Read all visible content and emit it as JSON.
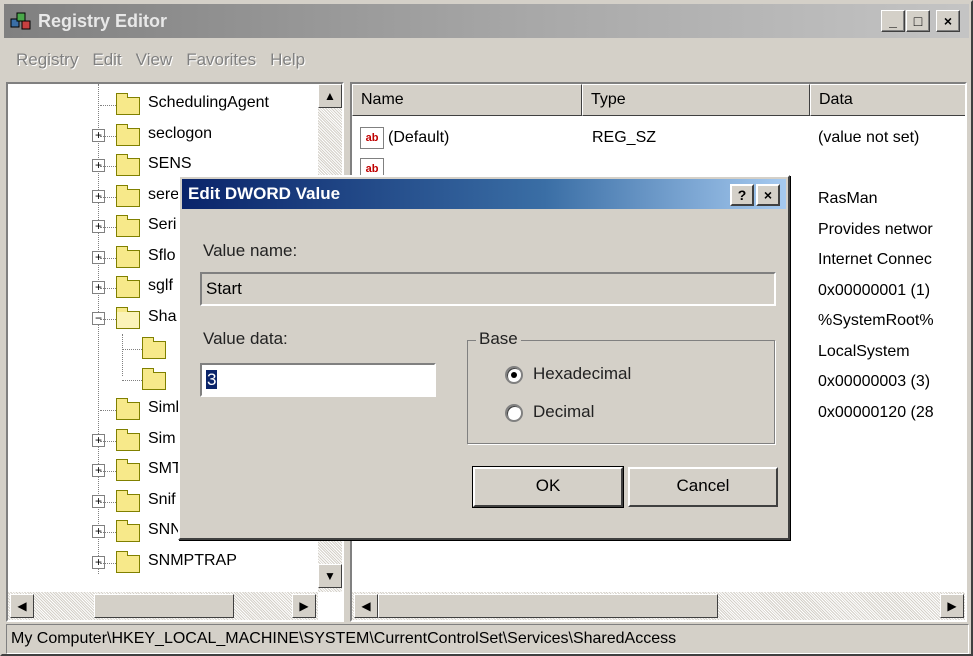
{
  "window": {
    "title": "Registry Editor",
    "minimize": "_",
    "maximize": "□",
    "close": "×"
  },
  "menu": [
    "Registry",
    "Edit",
    "View",
    "Favorites",
    "Help"
  ],
  "tree": [
    {
      "label": "SchedulingAgent",
      "expander": ""
    },
    {
      "label": "seclogon",
      "expander": "+"
    },
    {
      "label": "SENS",
      "expander": "+"
    },
    {
      "label": "sere",
      "expander": "+"
    },
    {
      "label": "Seri",
      "expander": "+"
    },
    {
      "label": "Sflo",
      "expander": "+"
    },
    {
      "label": "sglf",
      "expander": "+"
    },
    {
      "label": "Sha",
      "expander": "−"
    },
    {
      "label": "",
      "expander": ""
    },
    {
      "label": "",
      "expander": ""
    },
    {
      "label": "Siml",
      "expander": ""
    },
    {
      "label": "Sim",
      "expander": "+"
    },
    {
      "label": "SMT",
      "expander": "+"
    },
    {
      "label": "Snif",
      "expander": "+"
    },
    {
      "label": "SNN",
      "expander": "+"
    },
    {
      "label": "SNMPTRAP",
      "expander": "+"
    }
  ],
  "list": {
    "columns": [
      "Name",
      "Type",
      "Data"
    ],
    "rows": [
      {
        "name": "(Default)",
        "type": "REG_SZ",
        "data": "(value not set)"
      },
      {
        "name": "",
        "type": "",
        "data": ""
      },
      {
        "name": "",
        "type": "",
        "data": "RasMan"
      },
      {
        "name": "",
        "type": "",
        "data": "Provides networ"
      },
      {
        "name": "",
        "type": "",
        "data": "Internet Connec"
      },
      {
        "name": "",
        "type": "",
        "data": "0x00000001 (1)"
      },
      {
        "name": "",
        "type": "",
        "data": "%SystemRoot%"
      },
      {
        "name": "",
        "type": "",
        "data": "LocalSystem"
      },
      {
        "name": "",
        "type": "",
        "data": "0x00000003 (3)"
      },
      {
        "name": "",
        "type": "",
        "data": "0x00000120 (28"
      }
    ]
  },
  "status": "My Computer\\HKEY_LOCAL_MACHINE\\SYSTEM\\CurrentControlSet\\Services\\SharedAccess",
  "dialog": {
    "title": "Edit DWORD Value",
    "help": "?",
    "close": "×",
    "value_name_label": "Value name:",
    "value_name": "Start",
    "value_data_label": "Value data:",
    "value_data": "3",
    "base_label": "Base",
    "hex_label": "Hexadecimal",
    "dec_label": "Decimal",
    "base_selected": "Hexadecimal",
    "ok": "OK",
    "cancel": "Cancel"
  },
  "icons": {
    "app": "registry-icon",
    "folder": "folder-icon",
    "string_value": "ab-string-icon"
  }
}
